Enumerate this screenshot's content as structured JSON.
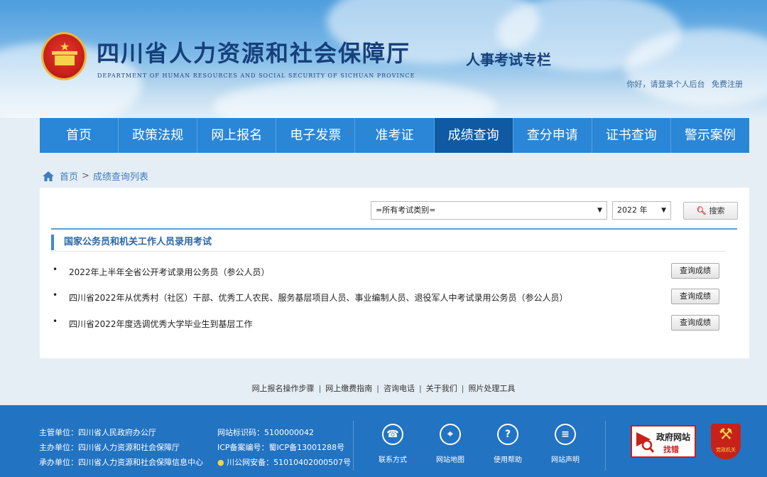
{
  "header": {
    "title": "四川省人力资源和社会保障厅",
    "subtitle_en": "DEPARTMENT OF HUMAN RESOURCES AND SOCIAL SECURITY OF SICHUAN PROVINCE",
    "section": "人事考试专栏",
    "login_text": "你好，请登录个人后台",
    "register_text": "免费注册"
  },
  "nav": {
    "items": [
      {
        "label": "首页"
      },
      {
        "label": "政策法规"
      },
      {
        "label": "网上报名"
      },
      {
        "label": "电子发票"
      },
      {
        "label": "准考证"
      },
      {
        "label": "成绩查询"
      },
      {
        "label": "查分申请"
      },
      {
        "label": "证书查询"
      },
      {
        "label": "警示案例"
      }
    ],
    "active": "成绩查询"
  },
  "breadcrumb": {
    "home": "首页",
    "separator": ">",
    "current": "成绩查询列表"
  },
  "filters": {
    "category": "=所有考试类别=",
    "year": "2022 年",
    "search_label": "搜索"
  },
  "category_title": "国家公务员和机关工作人员录用考试",
  "exams": [
    {
      "name": "2022年上半年全省公开考试录用公务员（参公人员）",
      "action": "查询成绩"
    },
    {
      "name": "四川省2022年从优秀村（社区）干部、优秀工人农民、服务基层项目人员、事业编制人员、退役军人中考试录用公务员（参公人员）",
      "action": "查询成绩"
    },
    {
      "name": "四川省2022年度选调优秀大学毕业生到基层工作",
      "action": "查询成绩"
    }
  ],
  "footer_links": [
    "网上报名操作步骤",
    "网上缴费指南",
    "咨询电话",
    "关于我们",
    "照片处理工具"
  ],
  "footer": {
    "org": [
      "主管单位：四川省人民政府办公厅",
      "主办单位：四川省人力资源和社会保障厅",
      "承办单位：四川省人力资源和社会保障信息中心"
    ],
    "reg": [
      "网站标识码：5100000042",
      "ICP备案编号：蜀ICP备13001288号",
      "川公网安备：51010402000507号"
    ],
    "icons": [
      {
        "label": "联系方式",
        "icon": "phone-icon"
      },
      {
        "label": "网站地图",
        "icon": "map-pin-icon"
      },
      {
        "label": "使用帮助",
        "icon": "help-icon"
      },
      {
        "label": "网站声明",
        "icon": "document-icon"
      }
    ],
    "error_box": {
      "line1": "政府网站",
      "line2": "找错"
    },
    "party_text": "党政机关"
  }
}
